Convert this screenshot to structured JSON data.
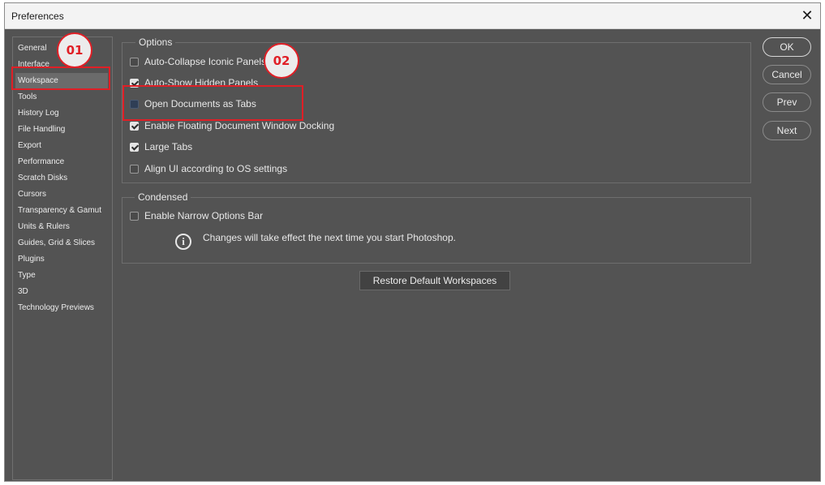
{
  "window": {
    "title": "Preferences"
  },
  "sidebar": {
    "items": [
      {
        "label": "General",
        "selected": false
      },
      {
        "label": "Interface",
        "selected": false
      },
      {
        "label": "Workspace",
        "selected": true
      },
      {
        "label": "Tools",
        "selected": false
      },
      {
        "label": "History Log",
        "selected": false
      },
      {
        "label": "File Handling",
        "selected": false
      },
      {
        "label": "Export",
        "selected": false
      },
      {
        "label": "Performance",
        "selected": false
      },
      {
        "label": "Scratch Disks",
        "selected": false
      },
      {
        "label": "Cursors",
        "selected": false
      },
      {
        "label": "Transparency & Gamut",
        "selected": false
      },
      {
        "label": "Units & Rulers",
        "selected": false
      },
      {
        "label": "Guides, Grid & Slices",
        "selected": false
      },
      {
        "label": "Plugins",
        "selected": false
      },
      {
        "label": "Type",
        "selected": false
      },
      {
        "label": "3D",
        "selected": false
      },
      {
        "label": "Technology Previews",
        "selected": false
      }
    ]
  },
  "options": {
    "legend": "Options",
    "items": [
      {
        "label": "Auto-Collapse Iconic Panels",
        "checked": false
      },
      {
        "label": "Auto-Show Hidden Panels",
        "checked": true
      },
      {
        "label": "Open Documents as Tabs",
        "checked": false
      },
      {
        "label": "Enable Floating Document Window Docking",
        "checked": true
      },
      {
        "label": "Large Tabs",
        "checked": true
      },
      {
        "label": "Align UI according to OS settings",
        "checked": false
      }
    ]
  },
  "condensed": {
    "legend": "Condensed",
    "items": [
      {
        "label": "Enable Narrow Options Bar",
        "checked": false
      }
    ],
    "info": "Changes will take effect the next time you start Photoshop."
  },
  "buttons": {
    "restore": "Restore Default Workspaces",
    "ok": "OK",
    "cancel": "Cancel",
    "prev": "Prev",
    "next": "Next"
  },
  "annotations": {
    "badge1": "01",
    "badge2": "02",
    "color": "#e01f26"
  },
  "icons": {
    "close": "close-icon",
    "info": "info-icon"
  }
}
